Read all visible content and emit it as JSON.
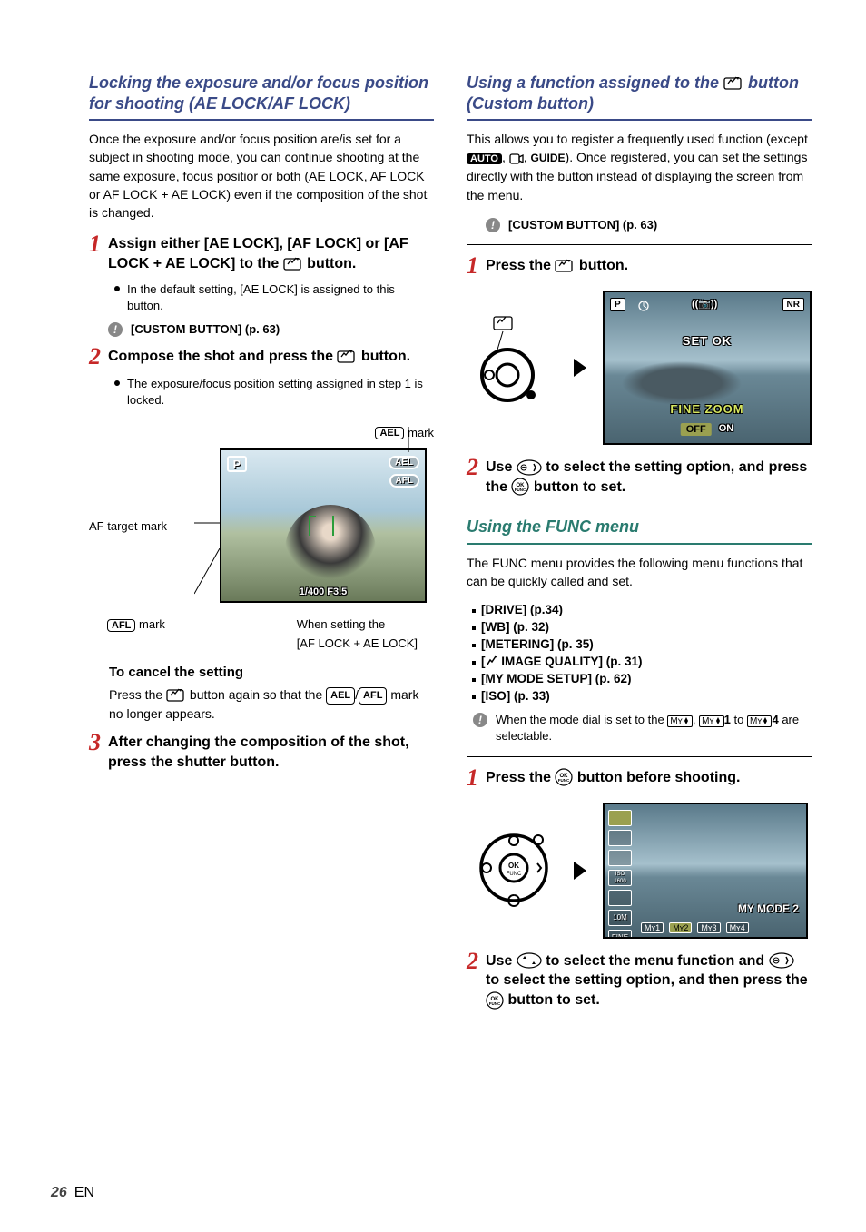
{
  "page": {
    "number": "26",
    "lang": "EN"
  },
  "left": {
    "heading": "Locking the exposure and/or focus position for shooting (AE LOCK/AF LOCK)",
    "intro": "Once the exposure and/or focus position are/is set for a subject in shooting mode, you can continue shooting at the same exposure, focus positior or both (AE LOCK, AF LOCK or AF LOCK + AE LOCK) even if the composition of the shot is changed.",
    "step1": {
      "num": "1",
      "text_a": "Assign either [AE LOCK], [AF LOCK] or [AF LOCK + AE LOCK] to the ",
      "text_b": " button.",
      "bullet": "In the default setting, [AE LOCK] is assigned to this button.",
      "note": "[CUSTOM BUTTON] (p. 63)"
    },
    "step2": {
      "num": "2",
      "text_a": "Compose the shot and press the ",
      "text_b": " button.",
      "bullet": "The exposure/focus position setting assigned in step 1 is locked."
    },
    "diagram": {
      "ael_mark_label": "mark",
      "ael_chip": "AEL",
      "af_target_label": "AF target mark",
      "afl_mark_label": "mark",
      "afl_chip": "AFL",
      "p_badge": "P",
      "shutter_info": "1/400   F3.5",
      "caption_a": "When setting the",
      "caption_b": "[AF LOCK + AE LOCK]"
    },
    "cancel": {
      "heading": "To cancel the setting",
      "body_a": "Press the ",
      "body_b": " button again so that the ",
      "body_c": " mark no longer appears.",
      "ael": "AEL",
      "afl": "AFL"
    },
    "step3": {
      "num": "3",
      "text": "After changing the composition of the shot, press the shutter button."
    }
  },
  "right": {
    "heading1": "Using a function assigned to the      button (Custom button)",
    "intro_a": "This allows you to register a frequently used function (except ",
    "intro_b": "). Once registered, you can set the settings directly with the button instead of displaying the screen from the menu.",
    "auto_chip": "AUTO",
    "guide_chip": "GUIDE",
    "note": "[CUSTOM BUTTON] (p. 63)",
    "r_step1": {
      "num": "1",
      "text_a": "Press the ",
      "text_b": " button."
    },
    "r_screenshot": {
      "p": "P",
      "nr": "NR",
      "set_ok": "SET   OK",
      "fine_zoom": "FINE ZOOM",
      "off": "OFF",
      "on": "ON"
    },
    "r_step2": {
      "num": "2",
      "text_a": "Use ",
      "text_b": " to select the setting option, and press the ",
      "text_c": " button to set."
    },
    "heading2": "Using the FUNC menu",
    "func_intro": "The FUNC menu provides the following menu functions that can be quickly called and set.",
    "func_items": [
      "[DRIVE] (p.34)",
      "[WB] (p. 32)",
      "[METERING] (p. 35)",
      "[      IMAGE QUALITY] (p. 31)",
      "[MY MODE SETUP] (p. 62)",
      "[ISO] (p. 33)"
    ],
    "func_note_a": "When the mode dial is set to the ",
    "func_note_b": " to ",
    "func_note_c": " are selectable.",
    "func_my1": "1",
    "func_my4": "4",
    "f_step1": {
      "num": "1",
      "text_a": "Press the ",
      "text_b": " button before shooting."
    },
    "func_screenshot": {
      "side": [
        "",
        "",
        "",
        "ISO\n1600",
        "",
        "10M",
        "FINE"
      ],
      "label": "MY MODE 2",
      "chips": [
        "1",
        "2",
        "3",
        "4"
      ]
    },
    "f_step2": {
      "num": "2",
      "text_a": "Use ",
      "text_b": " to select the menu function and ",
      "text_c": " to select the setting option, and then press the ",
      "text_d": " button to set."
    }
  }
}
